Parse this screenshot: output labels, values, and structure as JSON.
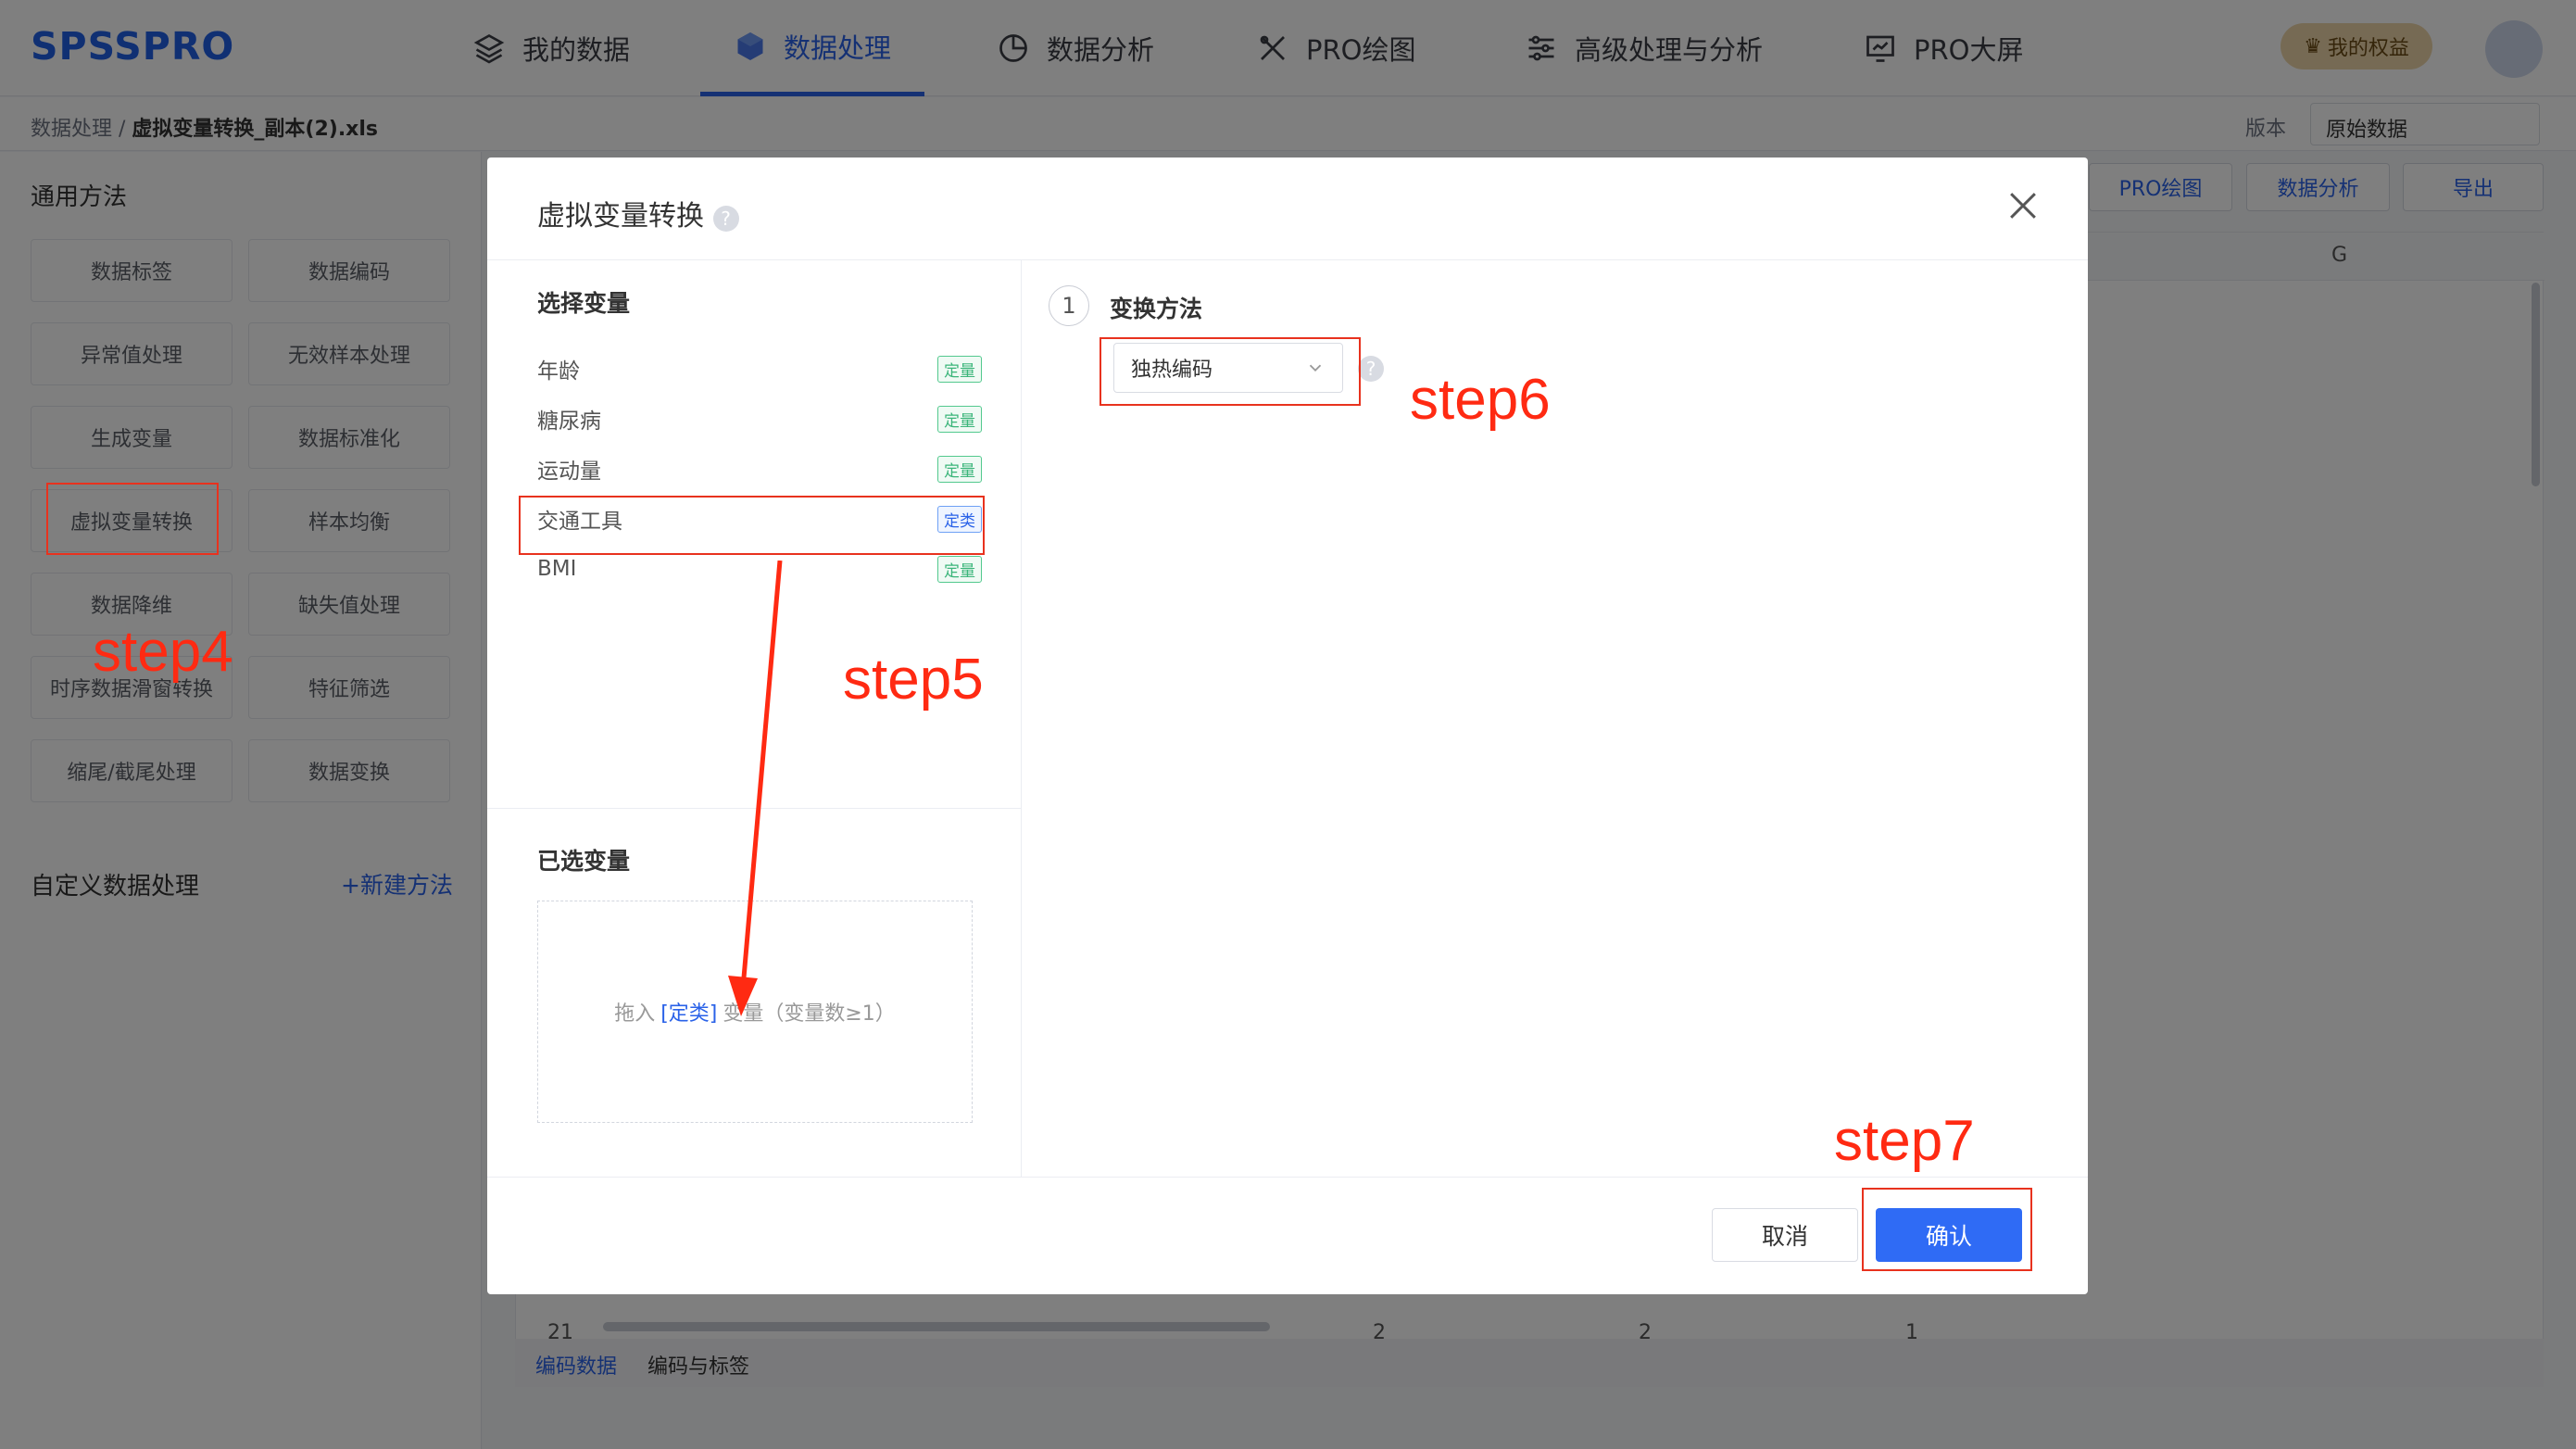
{
  "app": {
    "logo": "SPSSPRO"
  },
  "nav": {
    "items": [
      {
        "label": "我的数据",
        "icon": "layers-icon"
      },
      {
        "label": "数据处理",
        "icon": "cube-icon",
        "active": true
      },
      {
        "label": "数据分析",
        "icon": "pie-chart-icon"
      },
      {
        "label": "PRO绘图",
        "icon": "drawing-tools-icon"
      },
      {
        "label": "高级处理与分析",
        "icon": "sliders-icon"
      },
      {
        "label": "PRO大屏",
        "icon": "monitor-chart-icon"
      }
    ],
    "rights_label": "我的权益"
  },
  "breadcrumb": {
    "root": "数据处理 /",
    "file": "虚拟变量转换_副本(2).xls"
  },
  "version": {
    "label": "版本",
    "value": "原始数据"
  },
  "left_panel": {
    "title": "通用方法",
    "methods": [
      "数据标签",
      "数据编码",
      "异常值处理",
      "无效样本处理",
      "生成变量",
      "数据标准化",
      "虚拟变量转换",
      "样本均衡",
      "数据降维",
      "缺失值处理",
      "时序数据滑窗转换",
      "特征筛选",
      "缩尾/截尾处理",
      "数据变换"
    ],
    "custom_title": "自定义数据处理",
    "new_method": "+新建方法"
  },
  "toolbar": {
    "buttons": [
      "PRO绘图",
      "数据分析",
      "导出"
    ]
  },
  "grid": {
    "column_letter": "G",
    "row_number": "21",
    "row_values": [
      "2",
      "2",
      "1"
    ]
  },
  "bottom_tabs": [
    "编码数据",
    "编码与标签"
  ],
  "dialog": {
    "title": "虚拟变量转换",
    "select_title": "选择变量",
    "variables": [
      {
        "name": "年龄",
        "tag": "定量"
      },
      {
        "name": "糖尿病",
        "tag": "定量"
      },
      {
        "name": "运动量",
        "tag": "定量"
      },
      {
        "name": "交通工具",
        "tag": "定类"
      },
      {
        "name": "BMI",
        "tag": "定量"
      }
    ],
    "chosen_title": "已选变量",
    "drop_hint_pre": "拖入",
    "drop_hint_kind": "[定类]",
    "drop_hint_post": "变量（变量数≥1）",
    "step_number": "1",
    "method_title": "变换方法",
    "method_value": "独热编码",
    "cancel_label": "取消",
    "ok_label": "确认"
  },
  "annotations": {
    "step4": "step4",
    "step5": "step5",
    "step6": "step6",
    "step7": "step7"
  }
}
